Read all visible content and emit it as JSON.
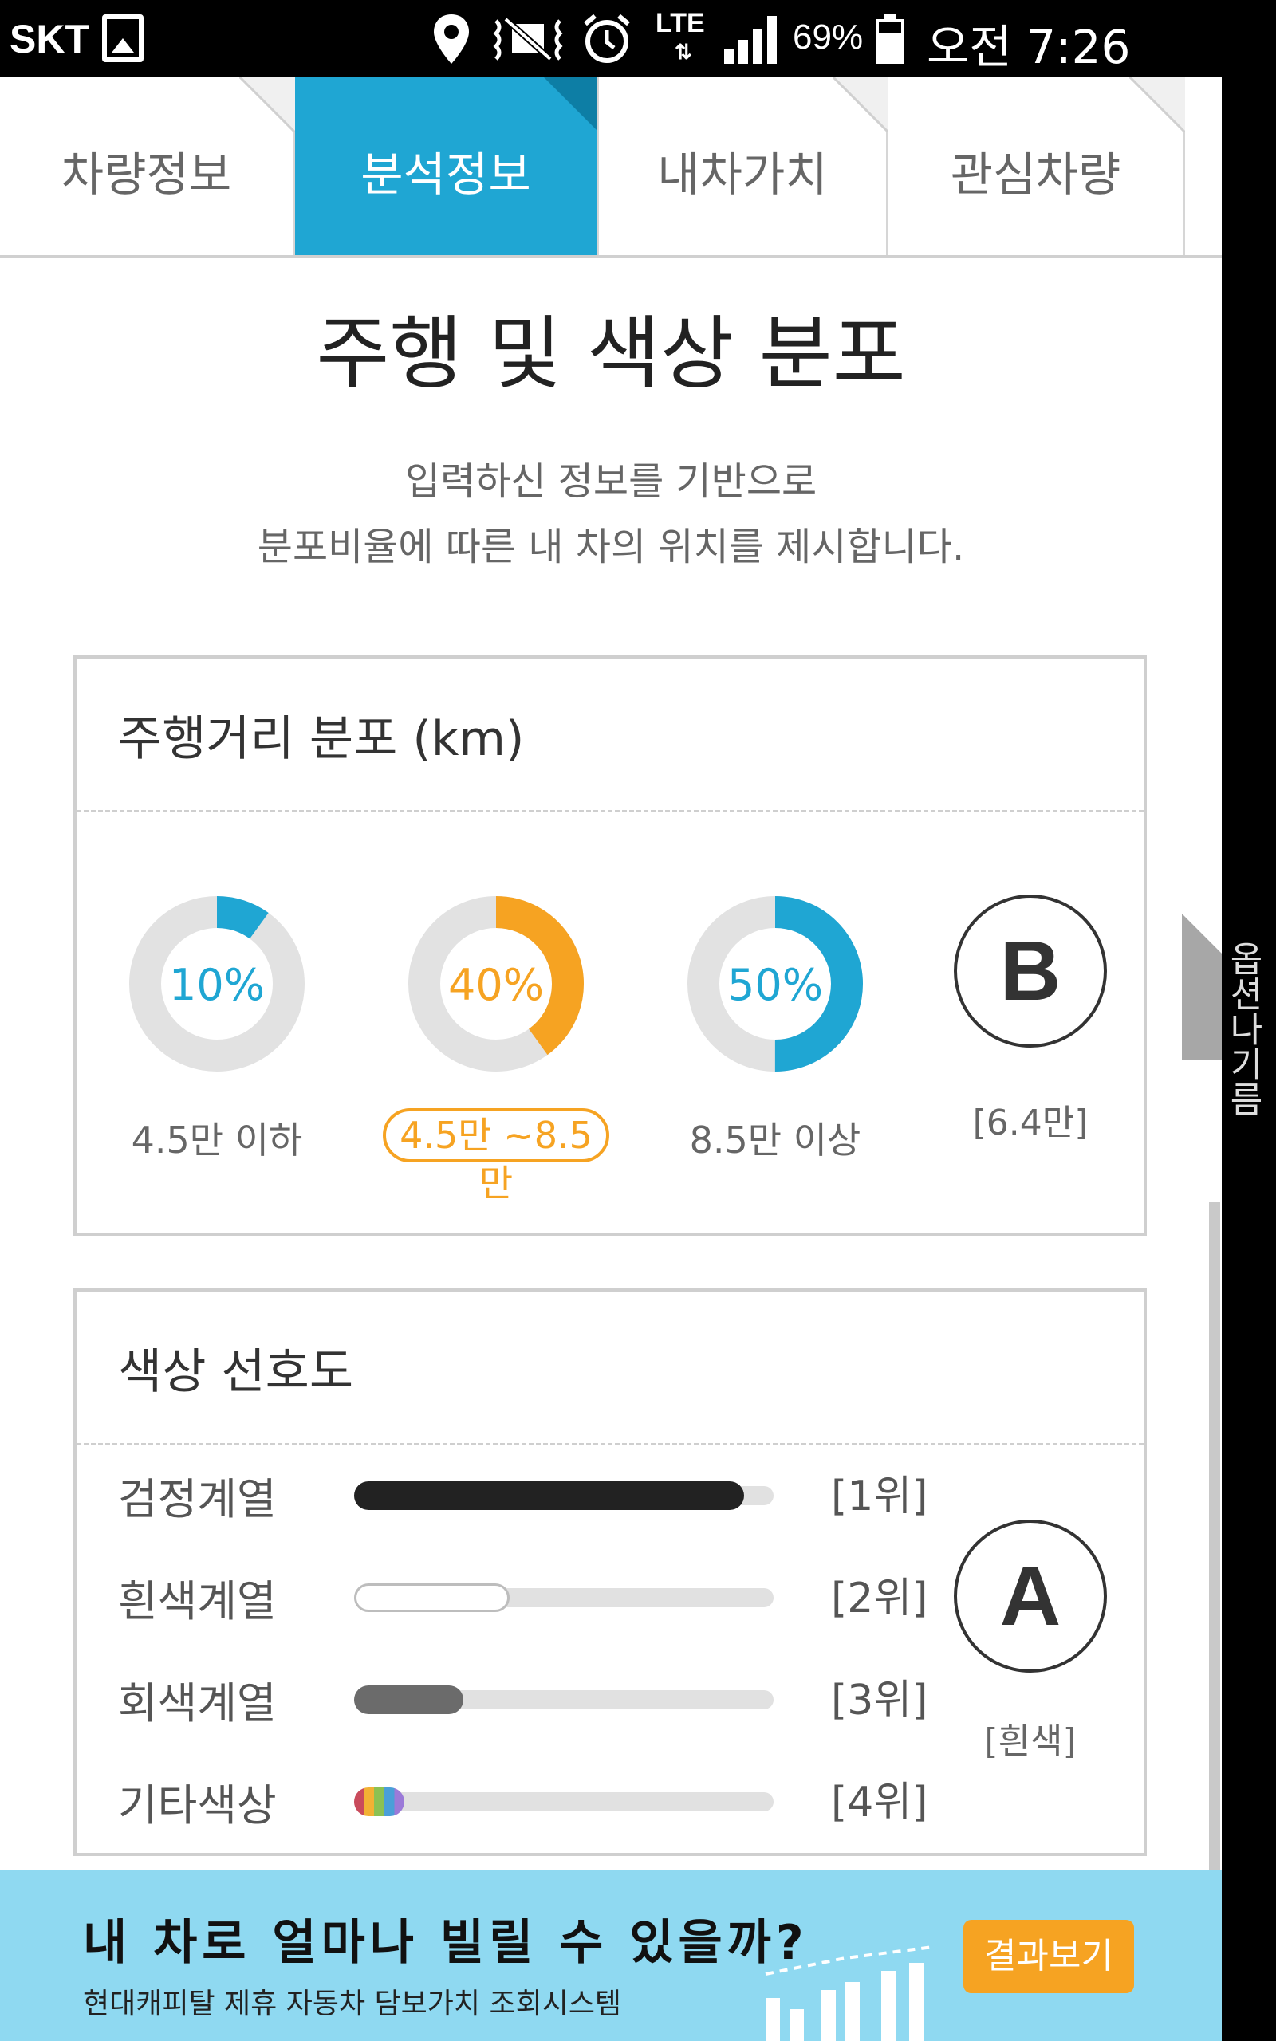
{
  "status_bar": {
    "carrier": "SKT",
    "network": "LTE",
    "network_arrows": "⇅",
    "battery": "69%",
    "time": "오전 7:26"
  },
  "tabs": [
    {
      "label": "차량정보",
      "active": false
    },
    {
      "label": "분석정보",
      "active": true
    },
    {
      "label": "내차가치",
      "active": false
    },
    {
      "label": "관심차량",
      "active": false
    }
  ],
  "page": {
    "title": "주행 및 색상 분포",
    "description": [
      "입력하신 정보를 기반으로",
      "분포비율에 따른 내 차의 위치를 제시합니다."
    ]
  },
  "mileage": {
    "title": "주행거리 분포 (km)",
    "items": [
      {
        "percent_label": "10%",
        "value": 0.1,
        "label": "4.5만 이하",
        "color": "#1fa6d3",
        "selected": false
      },
      {
        "percent_label": "40%",
        "value": 0.4,
        "label": "4.5만 ~8.5만",
        "color": "#f6a322",
        "selected": true
      },
      {
        "percent_label": "50%",
        "value": 0.5,
        "label": "8.5만 이상",
        "color": "#1fa6d3",
        "selected": false
      }
    ],
    "grade": "B",
    "grade_note": "[6.4만]"
  },
  "color_pref": {
    "title": "색상 선호도",
    "rows": [
      {
        "label": "검정계열",
        "value": 0.93,
        "rank": "[1위]",
        "fill": "#222222"
      },
      {
        "label": "흰색계열",
        "value": 0.37,
        "rank": "[2위]",
        "fill": "#ffffff"
      },
      {
        "label": "회색계열",
        "value": 0.26,
        "rank": "[3위]",
        "fill": "#6b6b6b"
      },
      {
        "label": "기타색상",
        "value": 0.12,
        "rank": "[4위]",
        "fill": "rainbow"
      }
    ],
    "grade": "A",
    "grade_note": "[흰색]"
  },
  "side_handle": {
    "label": "옵션나기름"
  },
  "banner": {
    "title": "내 차로 얼마나 빌릴 수 있을까?",
    "subtitle": "현대캐피탈 제휴 자동차 담보가치 조회시스템",
    "button": "결과보기"
  },
  "colors": {
    "accent_blue": "#1fa6d3",
    "accent_orange": "#f6a322",
    "banner_bg": "#8fd9f1"
  }
}
